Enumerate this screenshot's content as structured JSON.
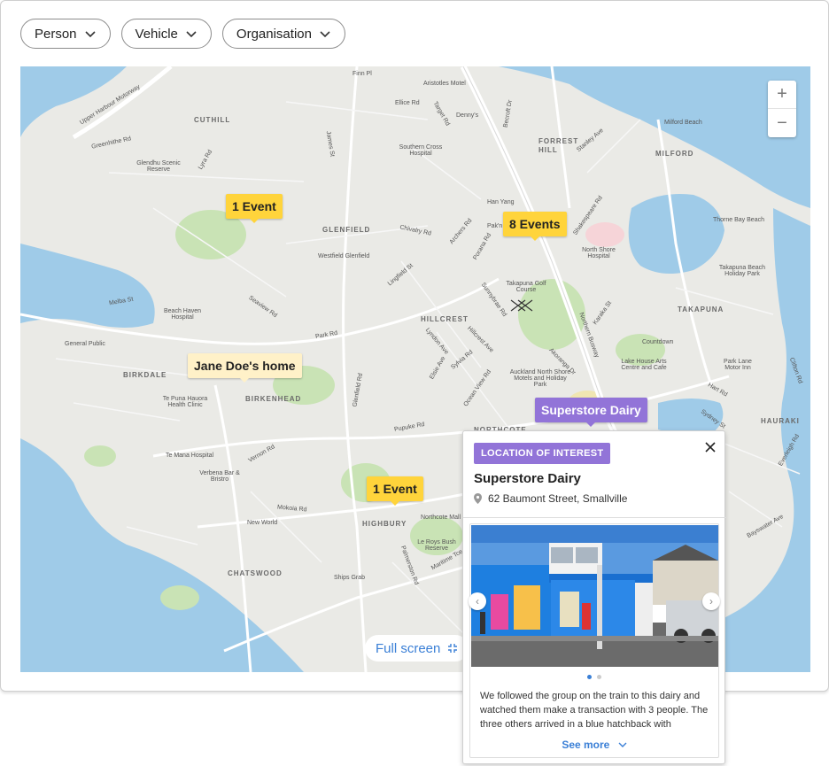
{
  "filters": [
    {
      "label": "Person"
    },
    {
      "label": "Vehicle"
    },
    {
      "label": "Organisation"
    }
  ],
  "map": {
    "zoom_in": "+",
    "zoom_out": "−",
    "fullscreen_label": "Full screen",
    "suburbs": [
      "CUTHILL",
      "FORREST HILL",
      "MILFORD",
      "GLENFIELD",
      "HILLCREST",
      "TAKAPUNA",
      "BIRKDALE",
      "BIRKENHEAD",
      "NORTHCOTE",
      "HAURAKI",
      "HIGHBURY",
      "CHATSWOOD"
    ],
    "places": [
      "Finn Pl",
      "Aristotles Motel",
      "Ellice Rd",
      "Denny's",
      "Target Rd",
      "Becroft Dr",
      "Upper Harbour Motorway",
      "Greenhithe Rd",
      "Glendhu Scenic Reserve",
      "Lyra Rd",
      "James St",
      "Southern Cross Hospital",
      "Stanley Ave",
      "Milford Beach",
      "Han Yang",
      "Pak'n Save",
      "North Shore Hospital",
      "Thorne Bay Beach",
      "Chivalry Rd",
      "Westfield Glenfield",
      "Archers Rd",
      "Porana Rd",
      "Shakespeare Rd",
      "Takapuna Beach Holiday Park",
      "Melba St",
      "Beach Haven Hospital",
      "Seaview Rd",
      "Lingfield St",
      "Takapuna Golf Course",
      "Sunnybrae Rd",
      "Karaka St",
      "General Public",
      "Park Rd",
      "Lyndon Ave",
      "Hillcrest Ave",
      "Northern Busway",
      "Countdown",
      "Sylvia Rd",
      "Elsie Ave",
      "Akoranga Dr",
      "Lake House Arts Centre and Cafe",
      "Park Lane Motor Inn",
      "Auckland North Shore Motels and Holiday Park",
      "Te Puna Hauora Health Clinic",
      "Ocean View Rd",
      "Hart Rd",
      "Te Mana Hospital",
      "Pupuke Rd",
      "Sydney St",
      "Verbena Bar & Bristro",
      "Vernon Rd",
      "Mokoia Rd",
      "New World",
      "Northcote Mall",
      "Le Roys Bush Reserve",
      "Maritime Tce",
      "Ships Grab",
      "Palmerston Rd",
      "Clifton Rd",
      "Everleigh Rd",
      "Bayswater Ave",
      "Glenfield Rd"
    ]
  },
  "markers": {
    "event1": "1 Event",
    "event8": "8 Events",
    "event3": "1 Event",
    "home": "Jane Doe's home",
    "selected": "Superstore Dairy"
  },
  "popup": {
    "badge": "LOCATION OF INTEREST",
    "title": "Superstore Dairy",
    "address": "62 Baumont Street, Smallville",
    "prev": "‹",
    "next": "›",
    "description": "We followed the group on the train to this dairy and watched them make a transaction with 3 people. The three others arrived in a blue hatchback with",
    "see_more": "See more"
  },
  "colors": {
    "event": "#ffd43b",
    "home": "#fff1c8",
    "selected": "#9274d8",
    "link": "#3a7fd6",
    "water": "#9fcbe8",
    "park": "#c9e3b5"
  }
}
